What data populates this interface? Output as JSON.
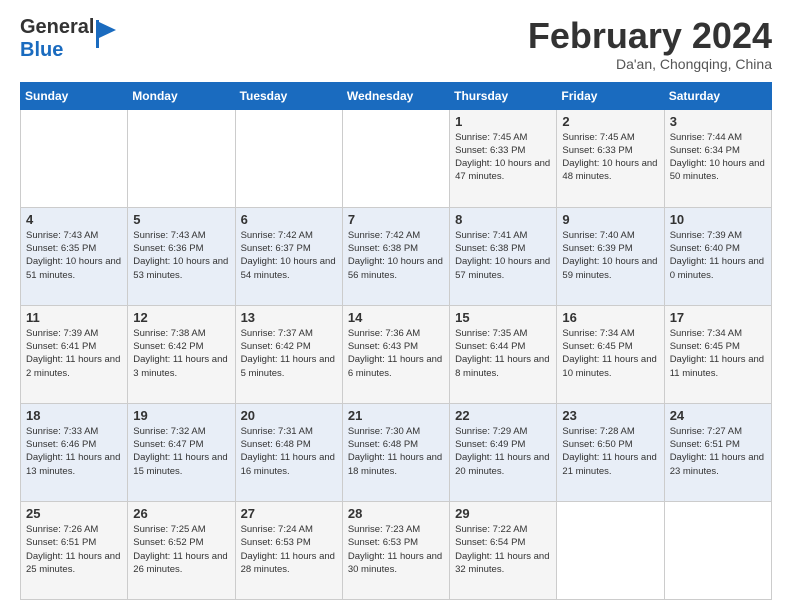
{
  "header": {
    "logo_general": "General",
    "logo_blue": "Blue",
    "month_title": "February 2024",
    "location": "Da'an, Chongqing, China"
  },
  "days_of_week": [
    "Sunday",
    "Monday",
    "Tuesday",
    "Wednesday",
    "Thursday",
    "Friday",
    "Saturday"
  ],
  "weeks": [
    [
      {
        "num": "",
        "sunrise": "",
        "sunset": "",
        "daylight": ""
      },
      {
        "num": "",
        "sunrise": "",
        "sunset": "",
        "daylight": ""
      },
      {
        "num": "",
        "sunrise": "",
        "sunset": "",
        "daylight": ""
      },
      {
        "num": "",
        "sunrise": "",
        "sunset": "",
        "daylight": ""
      },
      {
        "num": "1",
        "sunrise": "Sunrise: 7:45 AM",
        "sunset": "Sunset: 6:33 PM",
        "daylight": "Daylight: 10 hours and 47 minutes."
      },
      {
        "num": "2",
        "sunrise": "Sunrise: 7:45 AM",
        "sunset": "Sunset: 6:33 PM",
        "daylight": "Daylight: 10 hours and 48 minutes."
      },
      {
        "num": "3",
        "sunrise": "Sunrise: 7:44 AM",
        "sunset": "Sunset: 6:34 PM",
        "daylight": "Daylight: 10 hours and 50 minutes."
      }
    ],
    [
      {
        "num": "4",
        "sunrise": "Sunrise: 7:43 AM",
        "sunset": "Sunset: 6:35 PM",
        "daylight": "Daylight: 10 hours and 51 minutes."
      },
      {
        "num": "5",
        "sunrise": "Sunrise: 7:43 AM",
        "sunset": "Sunset: 6:36 PM",
        "daylight": "Daylight: 10 hours and 53 minutes."
      },
      {
        "num": "6",
        "sunrise": "Sunrise: 7:42 AM",
        "sunset": "Sunset: 6:37 PM",
        "daylight": "Daylight: 10 hours and 54 minutes."
      },
      {
        "num": "7",
        "sunrise": "Sunrise: 7:42 AM",
        "sunset": "Sunset: 6:38 PM",
        "daylight": "Daylight: 10 hours and 56 minutes."
      },
      {
        "num": "8",
        "sunrise": "Sunrise: 7:41 AM",
        "sunset": "Sunset: 6:38 PM",
        "daylight": "Daylight: 10 hours and 57 minutes."
      },
      {
        "num": "9",
        "sunrise": "Sunrise: 7:40 AM",
        "sunset": "Sunset: 6:39 PM",
        "daylight": "Daylight: 10 hours and 59 minutes."
      },
      {
        "num": "10",
        "sunrise": "Sunrise: 7:39 AM",
        "sunset": "Sunset: 6:40 PM",
        "daylight": "Daylight: 11 hours and 0 minutes."
      }
    ],
    [
      {
        "num": "11",
        "sunrise": "Sunrise: 7:39 AM",
        "sunset": "Sunset: 6:41 PM",
        "daylight": "Daylight: 11 hours and 2 minutes."
      },
      {
        "num": "12",
        "sunrise": "Sunrise: 7:38 AM",
        "sunset": "Sunset: 6:42 PM",
        "daylight": "Daylight: 11 hours and 3 minutes."
      },
      {
        "num": "13",
        "sunrise": "Sunrise: 7:37 AM",
        "sunset": "Sunset: 6:42 PM",
        "daylight": "Daylight: 11 hours and 5 minutes."
      },
      {
        "num": "14",
        "sunrise": "Sunrise: 7:36 AM",
        "sunset": "Sunset: 6:43 PM",
        "daylight": "Daylight: 11 hours and 6 minutes."
      },
      {
        "num": "15",
        "sunrise": "Sunrise: 7:35 AM",
        "sunset": "Sunset: 6:44 PM",
        "daylight": "Daylight: 11 hours and 8 minutes."
      },
      {
        "num": "16",
        "sunrise": "Sunrise: 7:34 AM",
        "sunset": "Sunset: 6:45 PM",
        "daylight": "Daylight: 11 hours and 10 minutes."
      },
      {
        "num": "17",
        "sunrise": "Sunrise: 7:34 AM",
        "sunset": "Sunset: 6:45 PM",
        "daylight": "Daylight: 11 hours and 11 minutes."
      }
    ],
    [
      {
        "num": "18",
        "sunrise": "Sunrise: 7:33 AM",
        "sunset": "Sunset: 6:46 PM",
        "daylight": "Daylight: 11 hours and 13 minutes."
      },
      {
        "num": "19",
        "sunrise": "Sunrise: 7:32 AM",
        "sunset": "Sunset: 6:47 PM",
        "daylight": "Daylight: 11 hours and 15 minutes."
      },
      {
        "num": "20",
        "sunrise": "Sunrise: 7:31 AM",
        "sunset": "Sunset: 6:48 PM",
        "daylight": "Daylight: 11 hours and 16 minutes."
      },
      {
        "num": "21",
        "sunrise": "Sunrise: 7:30 AM",
        "sunset": "Sunset: 6:48 PM",
        "daylight": "Daylight: 11 hours and 18 minutes."
      },
      {
        "num": "22",
        "sunrise": "Sunrise: 7:29 AM",
        "sunset": "Sunset: 6:49 PM",
        "daylight": "Daylight: 11 hours and 20 minutes."
      },
      {
        "num": "23",
        "sunrise": "Sunrise: 7:28 AM",
        "sunset": "Sunset: 6:50 PM",
        "daylight": "Daylight: 11 hours and 21 minutes."
      },
      {
        "num": "24",
        "sunrise": "Sunrise: 7:27 AM",
        "sunset": "Sunset: 6:51 PM",
        "daylight": "Daylight: 11 hours and 23 minutes."
      }
    ],
    [
      {
        "num": "25",
        "sunrise": "Sunrise: 7:26 AM",
        "sunset": "Sunset: 6:51 PM",
        "daylight": "Daylight: 11 hours and 25 minutes."
      },
      {
        "num": "26",
        "sunrise": "Sunrise: 7:25 AM",
        "sunset": "Sunset: 6:52 PM",
        "daylight": "Daylight: 11 hours and 26 minutes."
      },
      {
        "num": "27",
        "sunrise": "Sunrise: 7:24 AM",
        "sunset": "Sunset: 6:53 PM",
        "daylight": "Daylight: 11 hours and 28 minutes."
      },
      {
        "num": "28",
        "sunrise": "Sunrise: 7:23 AM",
        "sunset": "Sunset: 6:53 PM",
        "daylight": "Daylight: 11 hours and 30 minutes."
      },
      {
        "num": "29",
        "sunrise": "Sunrise: 7:22 AM",
        "sunset": "Sunset: 6:54 PM",
        "daylight": "Daylight: 11 hours and 32 minutes."
      },
      {
        "num": "",
        "sunrise": "",
        "sunset": "",
        "daylight": ""
      },
      {
        "num": "",
        "sunrise": "",
        "sunset": "",
        "daylight": ""
      }
    ]
  ]
}
